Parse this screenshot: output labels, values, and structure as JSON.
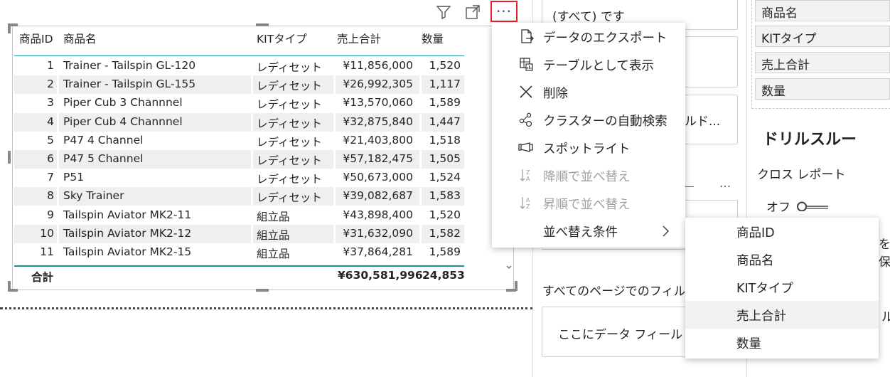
{
  "visual": {
    "headers": {
      "id": "商品ID",
      "name": "商品名",
      "kit": "KITタイプ",
      "sales": "売上合計",
      "qty": "数量"
    },
    "rows": [
      {
        "id": "1",
        "name": "Trainer - Tailspin GL-120",
        "kit": "レディセット",
        "sales": "¥11,856,000",
        "qty": "1,520"
      },
      {
        "id": "2",
        "name": "Trainer - Tailspin GL-155",
        "kit": "レディセット",
        "sales": "¥26,992,305",
        "qty": "1,117"
      },
      {
        "id": "3",
        "name": "Piper Cub 3 Channnel",
        "kit": "レディセット",
        "sales": "¥13,570,060",
        "qty": "1,589"
      },
      {
        "id": "4",
        "name": "Piper Cub 4 Channnel",
        "kit": "レディセット",
        "sales": "¥32,875,840",
        "qty": "1,447"
      },
      {
        "id": "5",
        "name": "P47 4 Channel",
        "kit": "レディセット",
        "sales": "¥21,403,800",
        "qty": "1,518"
      },
      {
        "id": "6",
        "name": "P47 5 Channel",
        "kit": "レディセット",
        "sales": "¥57,182,475",
        "qty": "1,505"
      },
      {
        "id": "7",
        "name": "P51",
        "kit": "レディセット",
        "sales": "¥50,673,000",
        "qty": "1,524"
      },
      {
        "id": "8",
        "name": "Sky Trainer",
        "kit": "レディセット",
        "sales": "¥39,082,687",
        "qty": "1,583"
      },
      {
        "id": "9",
        "name": "Tailspin Aviator MK2-11",
        "kit": "組立品",
        "sales": "¥43,898,400",
        "qty": "1,520"
      },
      {
        "id": "10",
        "name": "Tailspin Aviator MK2-12",
        "kit": "組立品",
        "sales": "¥31,632,090",
        "qty": "1,582"
      },
      {
        "id": "11",
        "name": "Tailspin Aviator MK2-15",
        "kit": "組立品",
        "sales": "¥37,864,281",
        "qty": "1,589"
      }
    ],
    "total": {
      "label": "合計",
      "sales": "¥630,581,996",
      "qty": "24,853"
    },
    "more_options": "···"
  },
  "context_menu": {
    "items": [
      {
        "label": "データのエクスポート",
        "icon": "export-icon",
        "enabled": true
      },
      {
        "label": "テーブルとして表示",
        "icon": "table-view-icon",
        "enabled": true
      },
      {
        "label": "削除",
        "icon": "close-icon",
        "enabled": true
      },
      {
        "label": "クラスターの自動検索",
        "icon": "cluster-icon",
        "enabled": true
      },
      {
        "label": "スポットライト",
        "icon": "spotlight-icon",
        "enabled": true
      },
      {
        "label": "降順で並べ替え",
        "icon": "sort-descending-icon",
        "enabled": false
      },
      {
        "label": "昇順で並べ替え",
        "icon": "sort-ascending-icon",
        "enabled": false
      },
      {
        "label": "並べ替え条件",
        "icon": "chevron-right-icon",
        "enabled": true
      }
    ],
    "submenu": [
      "商品ID",
      "商品名",
      "KITタイプ",
      "売上合計",
      "数量"
    ],
    "submenu_hovered": "売上合計"
  },
  "filters_pane": {
    "card1_text": "(すべて) です",
    "card3_text_tail": "ルド...",
    "section_ellipsis": "...",
    "all_pages_label": "すべてのページでのフィル",
    "drop_placeholder": "ここにデータ フィール"
  },
  "fields_pane": {
    "items": [
      "商品名",
      "KITタイプ",
      "売上合計",
      "数量"
    ],
    "drillthrough_title": "ドリルスルー",
    "cross_report_label": "クロス レポート",
    "toggle_label": "オフ",
    "clip_text_1": "を保",
    "clip_text_2": "ル"
  },
  "colors": {
    "accent": "#1f8f9a",
    "highlight_border": "#e8202a",
    "disabled": "#a19f9d"
  }
}
